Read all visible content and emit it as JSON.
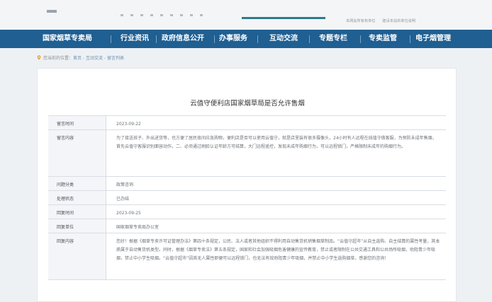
{
  "header": {
    "links": [
      "本网站所有权单位",
      "建设本站的单位说明"
    ]
  },
  "nav": {
    "items": [
      "国家烟草专卖局",
      "行业资讯",
      "政府信息公开",
      "办事服务",
      "互动交流",
      "专题专栏",
      "专卖监管",
      "电子烟管理"
    ]
  },
  "breadcrumb": {
    "prefix": "您当前的位置：",
    "trail": "首页 - 互动交流 - 留言列表"
  },
  "message": {
    "title": "云值守便利店国家烟草局是否允许售烟",
    "rows": [
      {
        "label": "留言时间",
        "value": "2023-09-22"
      },
      {
        "label": "留言内容",
        "value": "为了接送孩子、外出进货等，也方便了居民夜间应急购物，便利店是否可以使用云值守，就是店里装有很多摄像头，24小时有人远程在线值守做客服，为预防未成年售烟，首先云值守客服识别面容动作。二、必须通过刷脸认证年龄方可结算，大门远程遥控，发现未成年购烟行为，可以远程锁门，严格限制未成年的购烟行为。"
      },
      {
        "label": "问题分类",
        "value": "政策咨询"
      },
      {
        "label": "处理状态",
        "value": "已办结"
      },
      {
        "label": "回复时间",
        "value": "2023-09-25"
      },
      {
        "label": "回复单位",
        "value": "国家烟草专卖局办公室"
      },
      {
        "label": "回复内容",
        "value": "您好！根据《烟草专卖许可证管理办法》第四十条规定，公民、法人或者其他组织不得利用自动售货机销售烟草制品。“云值守超市”从自主选购、自主结算的属性考量，其本质属于自动售货机类型。同时，根据《烟草专卖法》第五条规定，国家和社会加强吸烟危害健康的宣传教育，禁止或者限制在公共交通工具和公共场所吸烟，劝阻青少年吸烟，禁止中小学生吸烟。“云值守超市”因其无人属性即便可以远程锁门，也无法有效劝阻青少年吸烟，并禁止中小学生选购烟草，感谢您的咨询！"
      }
    ]
  },
  "colors": {
    "nav_bg": "#1f5f92",
    "accent_line": "#2d7d8a",
    "label_bg": "#f3f5f8"
  }
}
